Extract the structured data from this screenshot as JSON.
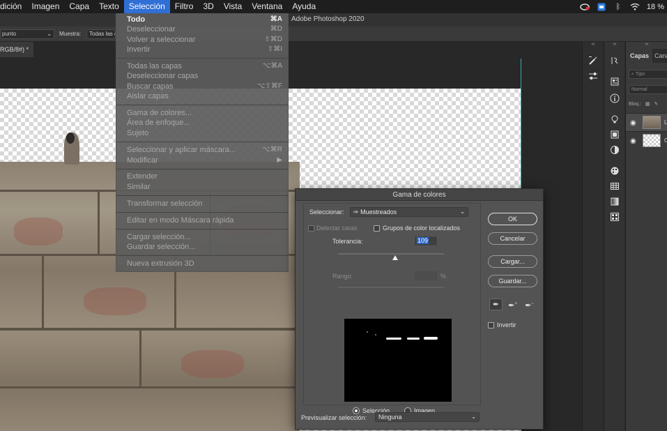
{
  "menubar": {
    "items": [
      "dición",
      "Imagen",
      "Capa",
      "Texto",
      "Selección",
      "Filtro",
      "3D",
      "Vista",
      "Ventana",
      "Ayuda"
    ],
    "active_index": 4,
    "battery": "18 %"
  },
  "app_title": "Adobe Photoshop 2020",
  "options_bar": {
    "sample_size": "punto",
    "sample_label": "Muestra:",
    "sample_value": "Todas las capas"
  },
  "document_tab": "RGB/8#) *",
  "selection_menu": {
    "items": [
      {
        "label": "Todo",
        "shortcut": "⌘A",
        "enabled": true,
        "bold": true
      },
      {
        "label": "Deseleccionar",
        "shortcut": "⌘D",
        "enabled": false
      },
      {
        "label": "Volver a seleccionar",
        "shortcut": "⇧⌘D",
        "enabled": false
      },
      {
        "label": "Invertir",
        "shortcut": "⇧⌘I",
        "enabled": false
      },
      {
        "label": "Todas las capas",
        "shortcut": "⌥⌘A",
        "enabled": false
      },
      {
        "label": "Deseleccionar capas",
        "shortcut": "",
        "enabled": false
      },
      {
        "label": "Buscar capas",
        "shortcut": "⌥⇧⌘F",
        "enabled": false
      },
      {
        "label": "Aislar capas",
        "shortcut": "",
        "enabled": false
      },
      {
        "label": "Gama de colores...",
        "shortcut": "",
        "enabled": false
      },
      {
        "label": "Área de enfoque...",
        "shortcut": "",
        "enabled": false
      },
      {
        "label": "Sujeto",
        "shortcut": "",
        "enabled": false
      },
      {
        "label": "Seleccionar y aplicar máscara...",
        "shortcut": "⌥⌘R",
        "enabled": false
      },
      {
        "label": "Modificar",
        "shortcut": "▶",
        "enabled": false
      },
      {
        "label": "Extender",
        "shortcut": "",
        "enabled": false
      },
      {
        "label": "Similar",
        "shortcut": "",
        "enabled": false
      },
      {
        "label": "Transformar selección",
        "shortcut": "",
        "enabled": false
      },
      {
        "label": "Editar en modo Máscara rápida",
        "shortcut": "",
        "enabled": false
      },
      {
        "label": "Cargar selección...",
        "shortcut": "",
        "enabled": false
      },
      {
        "label": "Guardar selección...",
        "shortcut": "",
        "enabled": false
      },
      {
        "label": "Nueva extrusión 3D",
        "shortcut": "",
        "enabled": false
      }
    ]
  },
  "layers_panel": {
    "tab_layers": "Capas",
    "tab_channels": "Canales",
    "search_placeholder": "Tipo",
    "blend_mode": "Normal",
    "lock_label": "Bloq.:",
    "layers": [
      {
        "name": "L",
        "selected": true,
        "thumb": "photo"
      },
      {
        "name": "C",
        "selected": false,
        "thumb": "transparent"
      }
    ]
  },
  "color_range_dialog": {
    "title": "Gama de colores",
    "select_label": "Seleccionar:",
    "select_value": "Muestreados",
    "detect_faces": "Detectar caras",
    "localized_groups": "Grupos de color localizados",
    "tolerance_label": "Tolerancia:",
    "tolerance_value": "109",
    "tolerance_fraction": 0.54,
    "range_label": "Rango:",
    "range_unit": "%",
    "radio_selection": "Selección",
    "radio_image": "Imagen",
    "preview_label": "Previsualizar selección:",
    "preview_value": "Ninguna",
    "buttons": {
      "ok": "OK",
      "cancel": "Cancelar",
      "load": "Cargar...",
      "save": "Guardar..."
    },
    "invert_label": "Invertir"
  }
}
